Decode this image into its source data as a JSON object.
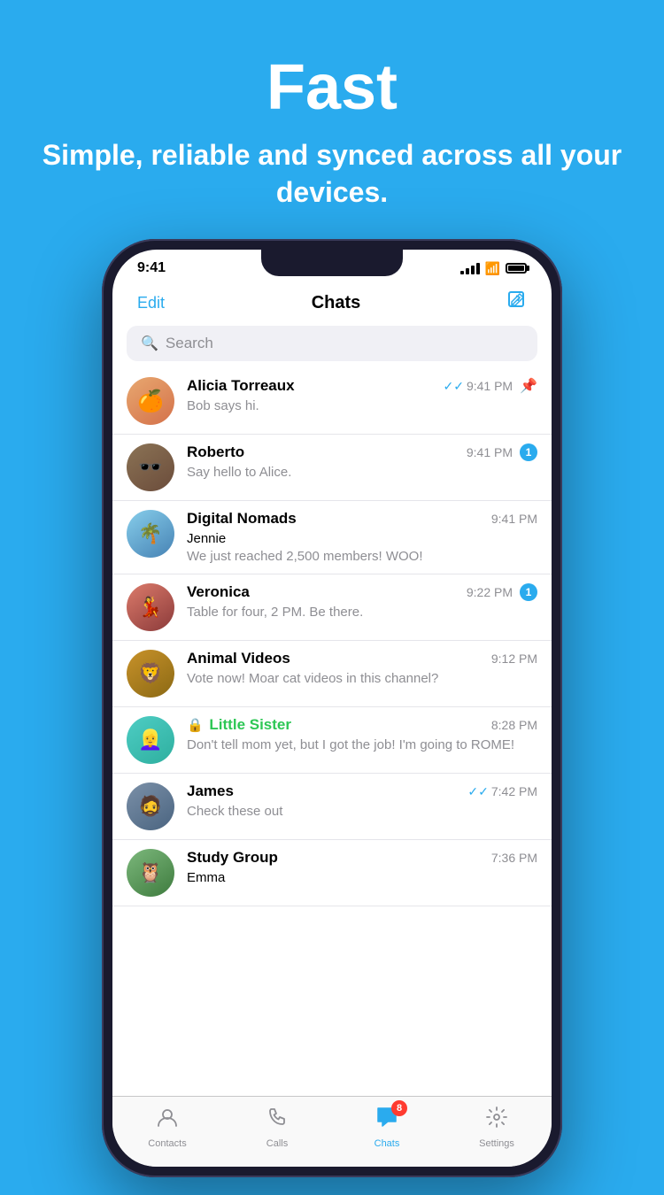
{
  "hero": {
    "title": "Fast",
    "subtitle": "Simple, reliable and synced across all your devices."
  },
  "phone": {
    "status_bar": {
      "time": "9:41",
      "signal": "●●●●",
      "wifi": "wifi",
      "battery": "battery"
    },
    "nav": {
      "edit_label": "Edit",
      "title": "Chats",
      "compose_icon": "compose"
    },
    "search": {
      "placeholder": "Search"
    },
    "chats": [
      {
        "id": "alicia",
        "name": "Alicia Torreaux",
        "preview": "Bob says hi.",
        "time": "9:41 PM",
        "double_check": true,
        "pinned": true,
        "unread": 0,
        "avatar_emoji": "🍊"
      },
      {
        "id": "roberto",
        "name": "Roberto",
        "preview": "Say hello to Alice.",
        "time": "9:41 PM",
        "double_check": false,
        "pinned": false,
        "unread": 1,
        "avatar_emoji": "🕶️"
      },
      {
        "id": "digital",
        "name": "Digital Nomads",
        "sender": "Jennie",
        "preview": "We just reached 2,500 members! WOO!",
        "time": "9:41 PM",
        "double_check": false,
        "pinned": false,
        "unread": 0,
        "avatar_emoji": "🌴"
      },
      {
        "id": "veronica",
        "name": "Veronica",
        "preview": "Table for four, 2 PM. Be there.",
        "time": "9:22 PM",
        "double_check": false,
        "pinned": false,
        "unread": 1,
        "avatar_emoji": "💃"
      },
      {
        "id": "animal",
        "name": "Animal Videos",
        "preview": "Vote now! Moar cat videos in this channel?",
        "time": "9:12 PM",
        "double_check": false,
        "pinned": false,
        "unread": 0,
        "avatar_emoji": "🦁"
      },
      {
        "id": "sister",
        "name": "Little Sister",
        "preview": "Don't tell mom yet, but I got the job! I'm going to ROME!",
        "time": "8:28 PM",
        "double_check": false,
        "pinned": false,
        "unread": 0,
        "locked": true,
        "avatar_emoji": "👱‍♀️"
      },
      {
        "id": "james",
        "name": "James",
        "preview": "Check these out",
        "time": "7:42 PM",
        "double_check": true,
        "pinned": false,
        "unread": 0,
        "avatar_emoji": "🧔"
      },
      {
        "id": "study",
        "name": "Study Group",
        "sender": "Emma",
        "preview": "",
        "time": "7:36 PM",
        "double_check": false,
        "pinned": false,
        "unread": 0,
        "avatar_emoji": "🦉"
      }
    ],
    "tab_bar": {
      "tabs": [
        {
          "id": "contacts",
          "label": "Contacts",
          "icon": "👤",
          "active": false,
          "badge": 0
        },
        {
          "id": "calls",
          "label": "Calls",
          "icon": "📞",
          "active": false,
          "badge": 0
        },
        {
          "id": "chats",
          "label": "Chats",
          "icon": "💬",
          "active": true,
          "badge": 8
        },
        {
          "id": "settings",
          "label": "Settings",
          "icon": "⚙️",
          "active": false,
          "badge": 0
        }
      ]
    }
  }
}
